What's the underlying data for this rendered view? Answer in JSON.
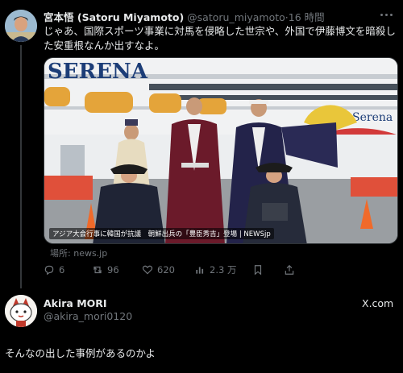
{
  "post": {
    "author_name": "宮本悟 (Satoru Miyamoto)",
    "handle": "@satoru_miyamoto",
    "separator": "·",
    "time": "16 時間",
    "text": "じゃあ、国際スポーツ事業に対馬を侵略した世宗や、外国で伊藤博文を暗殺した安重根なんか出すなよ。",
    "media": {
      "caption": "アジア大会行事に韓国が抗議　朝鮮出兵の「豊臣秀吉」登場 | NEWSjp",
      "ship_name": "SERENA",
      "ship_name_side": "Serena"
    },
    "source_label": "場所:",
    "source_domain": "news.jp",
    "metrics": {
      "replies": "6",
      "reposts": "96",
      "likes": "620",
      "views": "2.3 万"
    }
  },
  "reply": {
    "author_name": "Akira MORI",
    "handle": "@akira_mori0120",
    "platform_label": "X.com",
    "text": "そんなの出した事例があるのかよ"
  },
  "icons": [
    "more-icon",
    "reply-icon",
    "repost-icon",
    "like-icon",
    "views-icon",
    "bookmark-icon",
    "share-icon",
    "x-logo-icon"
  ],
  "colors": {
    "background": "#000000",
    "text": "#e7e9ea",
    "muted": "#71767b",
    "thread_line": "#333639"
  }
}
